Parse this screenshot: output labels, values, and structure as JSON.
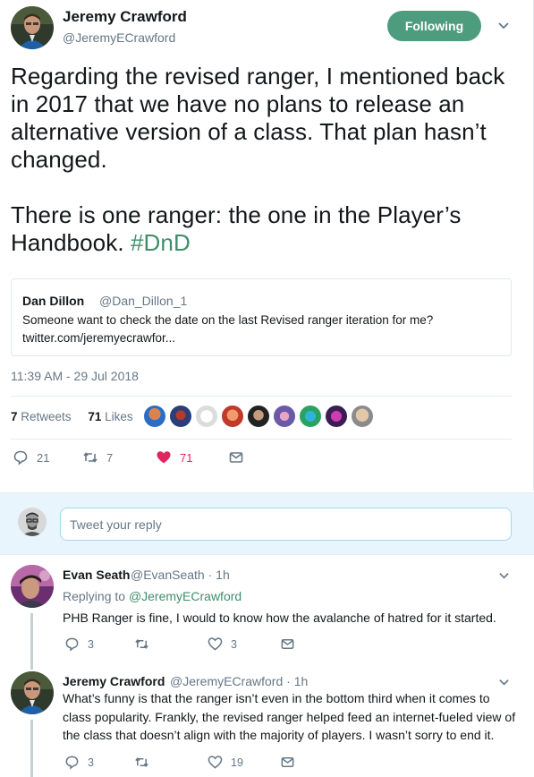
{
  "tweet": {
    "author_name": "Jeremy Crawford",
    "author_handle": "@JeremyECrawford",
    "follow_label": "Following",
    "text_p1": "Regarding the revised ranger, I mentioned back in 2017 that we have no plans to release an alternative version of a class. That plan hasn’t changed.",
    "text_p2": "There is one ranger: the one in the Player’s Handbook.",
    "hashtag": "#DnD",
    "timestamp": "11:39 AM - 29 Jul 2018",
    "retweets_count": "7",
    "retweets_label": "Retweets",
    "likes_count": "71",
    "likes_label": "Likes",
    "reply_count": "21",
    "retweet_action_count": "7",
    "like_action_count": "71"
  },
  "quote": {
    "name": "Dan Dillon",
    "handle": "@Dan_Dillon_1",
    "text": "Someone want to check the date on the last Revised ranger iteration for me?",
    "link": "twitter.com/jeremyecrawfor..."
  },
  "compose": {
    "placeholder": "Tweet your reply"
  },
  "replies": [
    {
      "name": "Evan Seath",
      "handle": "@EvanSeath",
      "time": "· 1h",
      "replying_prefix": "Replying to",
      "replying_to": "@JeremyECrawford",
      "text": "PHB Ranger is fine, I would to know how the avalanche of hatred for it started.",
      "reply_count": "3",
      "retweet_count": "",
      "like_count": "3"
    },
    {
      "name": "Jeremy Crawford",
      "handle": "@JeremyECrawford",
      "time": "· 1h",
      "text": "What’s funny is that the ranger isn’t even in the bottom third when it comes to class popularity. Frankly, the revised ranger helped feed an internet-fueled view of the class that doesn’t align with the majority of players. I wasn’t sorry to end it.",
      "reply_count": "3",
      "retweet_count": "",
      "like_count": "19"
    }
  ],
  "colors": {
    "accent": "#4d9c7e",
    "hashtag": "#3f8f6a",
    "muted": "#657786",
    "like": "#e0245e"
  },
  "icons": {
    "reply": "reply-icon",
    "retweet": "retweet-icon",
    "like": "heart-icon",
    "dm": "envelope-icon",
    "menu": "chevron-down-icon"
  }
}
